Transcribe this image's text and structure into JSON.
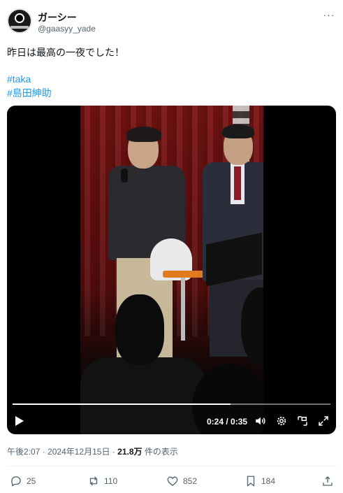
{
  "author": {
    "display_name": "ガーシー",
    "handle": "@gaasyy_yade",
    "avatar_icon": "avatar-logo-icon"
  },
  "tweet": {
    "text": "昨日は最高の一夜でした！",
    "hashtags": [
      "#taka",
      "#島田紳助"
    ]
  },
  "video": {
    "current_time": "0:24",
    "duration": "0:35",
    "time_display": "0:24 / 0:35",
    "progress_fraction": 0.686,
    "controls": [
      "play-icon",
      "volume-icon",
      "settings-gear-icon",
      "picture-in-picture-icon",
      "fullscreen-icon"
    ]
  },
  "meta": {
    "time": "午後2:07",
    "separator": "·",
    "date": "2024年12月15日",
    "views": "21.8万",
    "views_suffix": "件の表示"
  },
  "actions": {
    "replies": "25",
    "retweets": "110",
    "likes": "852",
    "bookmarks": "184"
  },
  "colors": {
    "link": "#1d9bf0",
    "secondary_text": "#536471",
    "primary_text": "#0f1419"
  }
}
